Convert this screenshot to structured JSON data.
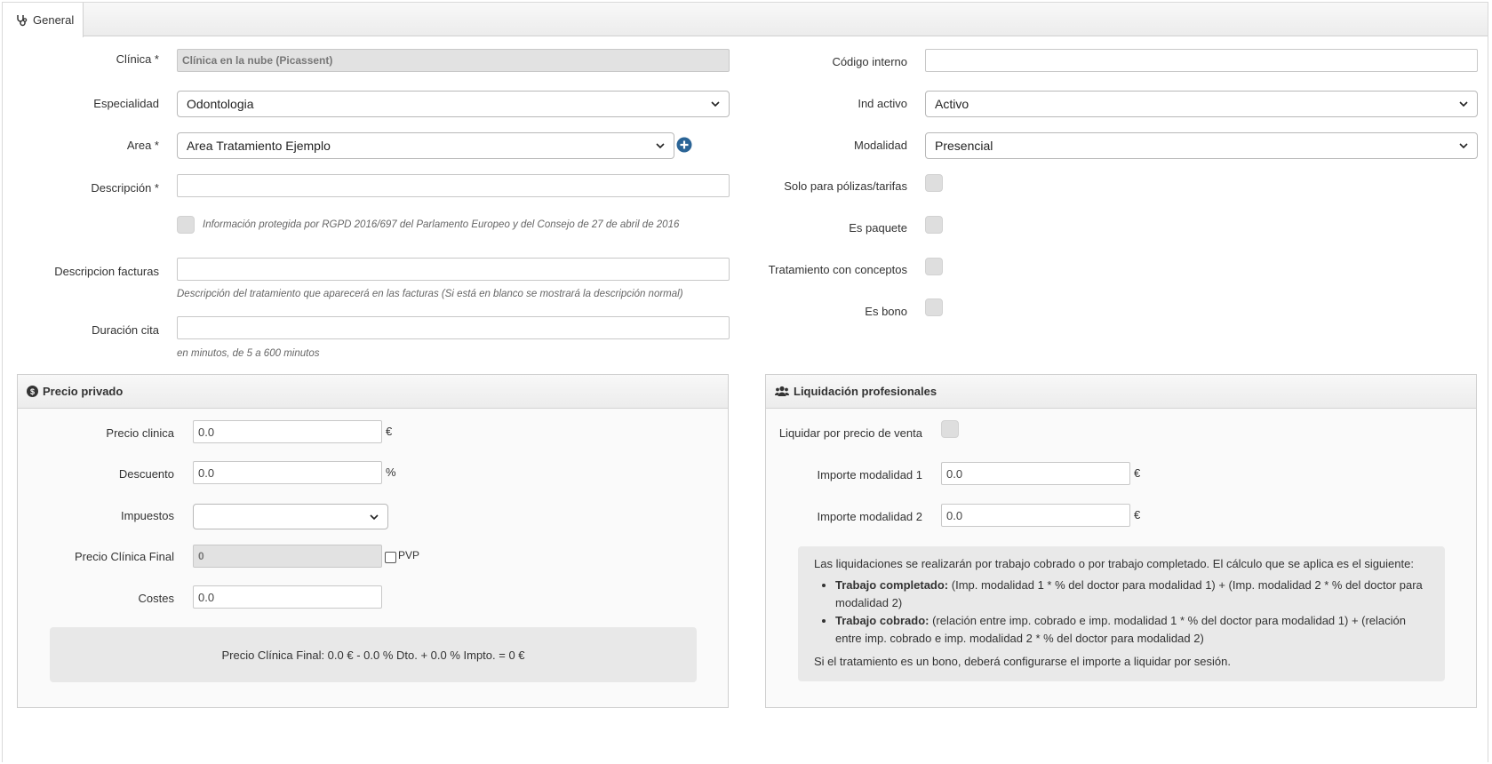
{
  "tab": {
    "label": "General",
    "icon": "stethoscope-icon"
  },
  "left": {
    "clinica": {
      "label": "Clínica *",
      "value": "Clínica en la nube (Picassent)"
    },
    "especialidad": {
      "label": "Especialidad",
      "value": "Odontologia"
    },
    "area": {
      "label": "Area *",
      "value": "Area Tratamiento Ejemplo"
    },
    "descripcion": {
      "label": "Descripción *",
      "value": ""
    },
    "rgpd": {
      "text": "Información protegida por RGPD 2016/697 del Parlamento Europeo y del Consejo de 27 de abril de 2016"
    },
    "desc_facturas": {
      "label": "Descripcion facturas",
      "value": "",
      "help": "Descripción del tratamiento que aparecerá en las facturas (Si está en blanco se mostrará la descripción normal)"
    },
    "duracion": {
      "label": "Duración cita",
      "value": "",
      "help": "en minutos, de 5 a 600 minutos"
    }
  },
  "right": {
    "codigo": {
      "label": "Código interno",
      "value": ""
    },
    "ind_activo": {
      "label": "Ind activo",
      "value": "Activo"
    },
    "modalidad": {
      "label": "Modalidad",
      "value": "Presencial"
    },
    "solo_polizas": {
      "label": "Solo para pólizas/tarifas"
    },
    "es_paquete": {
      "label": "Es paquete"
    },
    "con_conceptos": {
      "label": "Tratamiento con conceptos"
    },
    "es_bono": {
      "label": "Es bono"
    }
  },
  "precio": {
    "title": "Precio privado",
    "precio_clinica": {
      "label": "Precio clinica",
      "value": "0.0",
      "unit": "€"
    },
    "descuento": {
      "label": "Descuento",
      "value": "0.0",
      "unit": "%"
    },
    "impuestos": {
      "label": "Impuestos",
      "value": ""
    },
    "final": {
      "label": "Precio Clínica Final",
      "value": "0",
      "pvp": "PVP"
    },
    "costes": {
      "label": "Costes",
      "value": "0.0"
    },
    "summary": "Precio Clínica Final: 0.0 € - 0.0 % Dto. + 0.0 % Impto. = 0 €"
  },
  "liquidacion": {
    "title": "Liquidación profesionales",
    "liquidar": {
      "label": "Liquidar por precio de venta"
    },
    "mod1": {
      "label": "Importe modalidad 1",
      "value": "0.0",
      "unit": "€"
    },
    "mod2": {
      "label": "Importe modalidad 2",
      "value": "0.0",
      "unit": "€"
    },
    "info": {
      "intro": "Las liquidaciones se realizarán por trabajo cobrado o por trabajo completado. El cálculo que se aplica es el siguiente:",
      "item1_bold": "Trabajo completado:",
      "item1_text": " (Imp. modalidad 1 * % del doctor para modalidad 1) + (Imp. modalidad 2 * % del doctor para modalidad 2)",
      "item2_bold": "Trabajo cobrado:",
      "item2_text": " (relación entre imp. cobrado e imp. modalidad 1 * % del doctor para modalidad 1) + (relación entre imp. cobrado e imp. modalidad 2 * % del doctor para modalidad 2)",
      "footer": "Si el tratamiento es un bono, deberá configurarse el importe a liquidar por sesión."
    }
  },
  "colors": {
    "accent": "#2a6496",
    "panel_bg": "#fafafa",
    "readonly_bg": "#e2e2e2"
  }
}
